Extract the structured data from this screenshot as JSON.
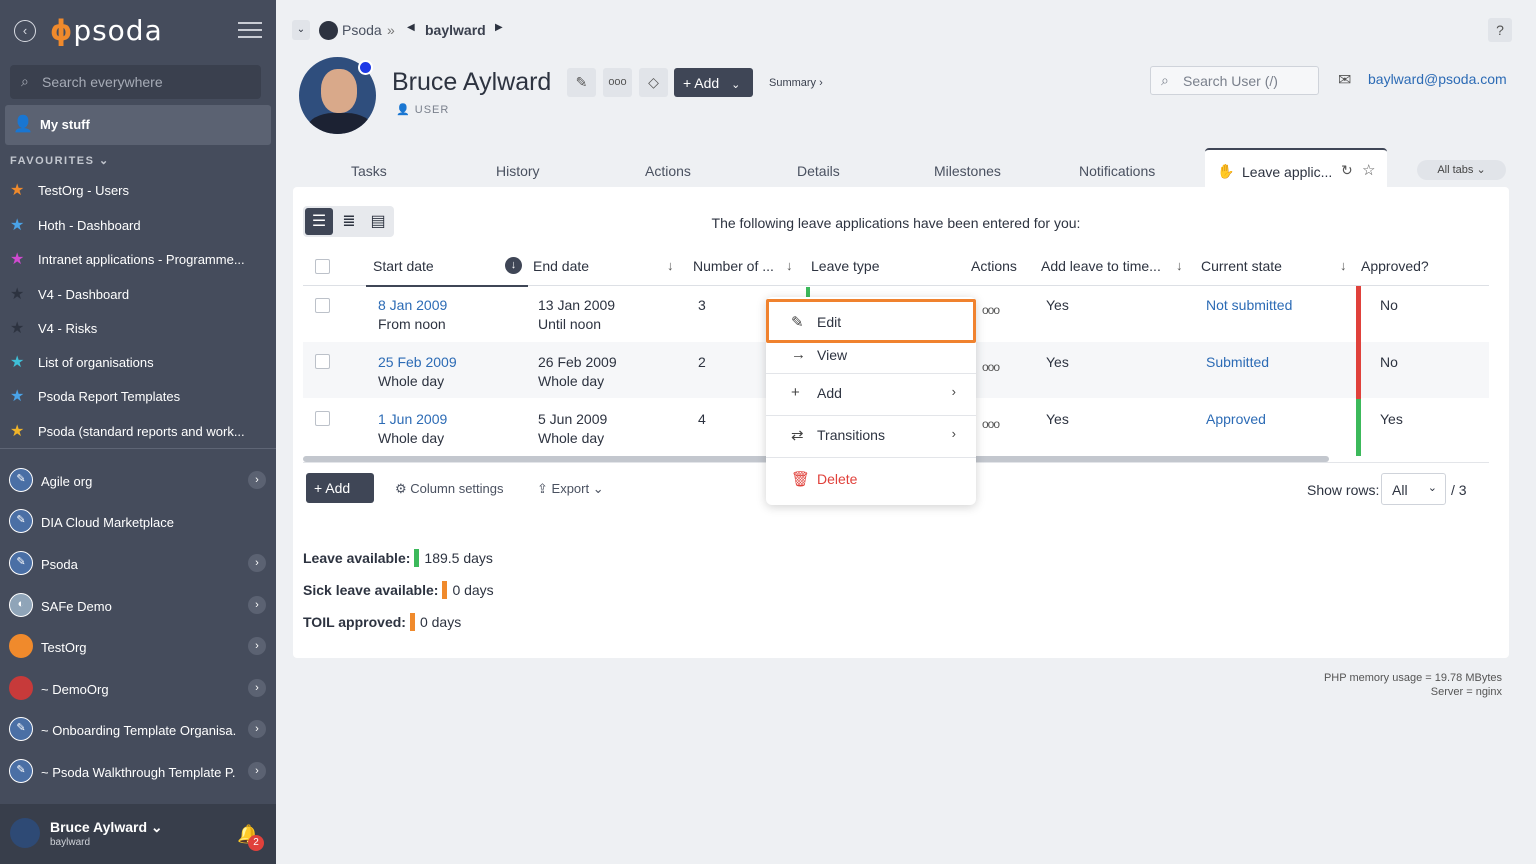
{
  "sidebar": {
    "logo": "psoda",
    "search_placeholder": "Search everywhere",
    "my_stuff": "My stuff",
    "favourites_header": "FAVOURITES",
    "favourites": [
      {
        "label": "TestOrg - Users",
        "color": "#f08a2c"
      },
      {
        "label": "Hoth - Dashboard",
        "color": "#4aa3e8"
      },
      {
        "label": "Intranet applications - Programme...",
        "color": "#d04ad0"
      },
      {
        "label": "V4 - Dashboard",
        "color": "#2d3340"
      },
      {
        "label": "V4 - Risks",
        "color": "#2d3340"
      },
      {
        "label": "List of organisations",
        "color": "#3fc0d8"
      },
      {
        "label": "Psoda Report Templates",
        "color": "#4aa3e8"
      },
      {
        "label": "Psoda (standard reports and work...",
        "color": "#f0b429"
      }
    ],
    "orgs": [
      {
        "label": "Agile org",
        "icon_bg": "#4a6fa5",
        "has_chevron": true
      },
      {
        "label": "DIA Cloud Marketplace",
        "icon_bg": "#4a6fa5",
        "has_chevron": false
      },
      {
        "label": "Psoda",
        "icon_bg": "#4a6fa5",
        "has_chevron": true
      },
      {
        "label": "SAFe Demo",
        "icon_bg": "#8fa4b8",
        "has_chevron": true
      },
      {
        "label": "TestOrg",
        "icon_bg": "#f08a2c",
        "has_chevron": true
      },
      {
        "label": "~ DemoOrg",
        "icon_bg": "#c73a3a",
        "has_chevron": true
      },
      {
        "label": "~ Onboarding Template Organisa...",
        "icon_bg": "#4a6fa5",
        "has_chevron": true
      },
      {
        "label": "~ Psoda Walkthrough Template P...",
        "icon_bg": "#4a6fa5",
        "has_chevron": true
      }
    ],
    "user_name": "Bruce Aylward",
    "user_handle": "baylward",
    "notification_count": "2"
  },
  "breadcrumb": {
    "root": "Psoda",
    "sep": "»",
    "current": "baylward"
  },
  "help_label": "?",
  "profile": {
    "name": "Bruce Aylward",
    "role": "USER",
    "add_label": "Add",
    "summary_label": "Summary ›",
    "search_user_placeholder": "Search User (/)",
    "email": "baylward@psoda.com"
  },
  "tabs": [
    "Tasks",
    "History",
    "Actions",
    "Details",
    "Milestones",
    "Notifications"
  ],
  "active_tab": "Leave applic...",
  "all_tabs_label": "All tabs",
  "panel": {
    "intro": "The following leave applications have been entered for you:",
    "columns": {
      "start_date": "Start date",
      "end_date": "End date",
      "number_of": "Number of ...",
      "leave_type": "Leave type",
      "actions": "Actions",
      "add_leave": "Add leave to time...",
      "current_state": "Current state",
      "approved": "Approved?"
    },
    "rows": [
      {
        "start": "8 Jan 2009",
        "start_sub": "From noon",
        "end": "13 Jan 2009",
        "end_sub": "Until noon",
        "number": "3",
        "add_leave": "Yes",
        "state": "Not submitted",
        "state_color": "#e0413b",
        "approved": "No"
      },
      {
        "start": "25 Feb 2009",
        "start_sub": "Whole day",
        "end": "26 Feb 2009",
        "end_sub": "Whole day",
        "number": "2",
        "add_leave": "Yes",
        "state": "Submitted",
        "state_color": "#e0413b",
        "approved": "No"
      },
      {
        "start": "1 Jun 2009",
        "start_sub": "Whole day",
        "end": "5 Jun 2009",
        "end_sub": "Whole day",
        "number": "4",
        "add_leave": "Yes",
        "state": "Approved",
        "state_color": "#3cb95b",
        "approved": "Yes"
      }
    ],
    "add_label": "Add",
    "column_settings_label": "Column settings",
    "export_label": "Export",
    "show_rows_label": "Show rows:",
    "show_rows_value": "All",
    "row_total": "/ 3",
    "leave_available_label": "Leave available:",
    "leave_available_value": "189.5 days",
    "sick_leave_label": "Sick leave available:",
    "sick_leave_value": "0 days",
    "toil_label": "TOIL approved:",
    "toil_value": "0 days"
  },
  "context_menu": {
    "edit": "Edit",
    "view": "View",
    "add": "Add",
    "transitions": "Transitions",
    "delete": "Delete"
  },
  "footer": {
    "memory": "PHP memory usage = 19.78 MBytes",
    "server": "Server = nginx"
  }
}
